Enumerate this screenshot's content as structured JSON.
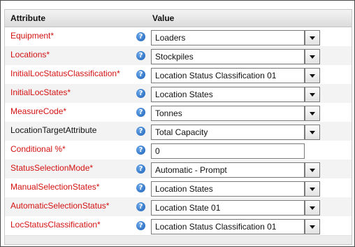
{
  "header": {
    "attribute": "Attribute",
    "value": "Value"
  },
  "rows": [
    {
      "label": "Equipment*",
      "value": "Loaders"
    },
    {
      "label": "Locations*",
      "value": "Stockpiles"
    },
    {
      "label": "InitialLocStatusClassification*",
      "value": "Location Status Classification 01"
    },
    {
      "label": "InitialLocStates*",
      "value": "Location States"
    },
    {
      "label": "MeasureCode*",
      "value": "Tonnes"
    },
    {
      "label": "LocationTargetAttribute",
      "value": "Total Capacity"
    },
    {
      "label": "Conditional %*",
      "value": "0"
    },
    {
      "label": "StatusSelectionMode*",
      "value": "Automatic - Prompt"
    },
    {
      "label": "ManualSelectionStates*",
      "value": "Location States"
    },
    {
      "label": "AutomaticSelectionStatus*",
      "value": "Location State 01"
    },
    {
      "label": "LocStatusClassification*",
      "value": "Location Status Classification 01"
    }
  ],
  "help_glyph": "?",
  "colors": {
    "required_label": "#d41111",
    "help_icon": "#1b5fb7"
  }
}
